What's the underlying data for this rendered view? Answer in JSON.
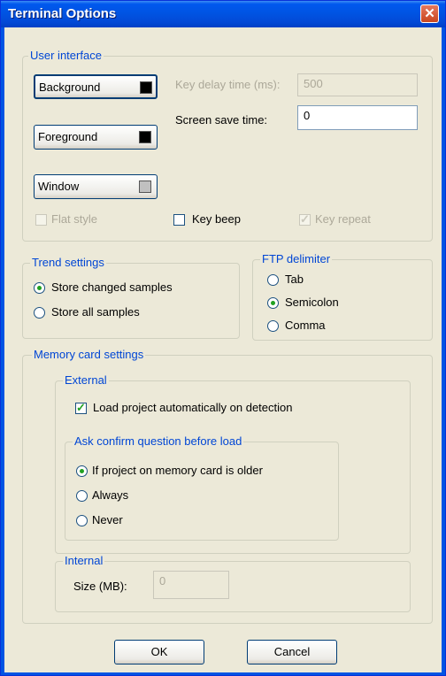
{
  "window": {
    "title": "Terminal Options",
    "close_glyph": "✕"
  },
  "user_interface": {
    "legend": "User interface",
    "background_button": "Background",
    "foreground_button": "Foreground",
    "window_button": "Window",
    "background_color": "#000000",
    "foreground_color": "#000000",
    "window_color": "#c0c0c0",
    "key_delay_label": "Key delay time (ms):",
    "key_delay_value": "500",
    "screen_save_label": "Screen save time:",
    "screen_save_value": "0",
    "flat_style_label": "Flat style",
    "key_beep_label": "Key beep",
    "key_repeat_label": "Key repeat"
  },
  "trend_settings": {
    "legend": "Trend settings",
    "store_changed": "Store changed samples",
    "store_all": "Store all samples"
  },
  "ftp_delimiter": {
    "legend": "FTP delimiter",
    "tab": "Tab",
    "semicolon": "Semicolon",
    "comma": "Comma"
  },
  "memory_card": {
    "legend": "Memory card settings",
    "external": {
      "legend": "External",
      "load_project_label": "Load project automatically on detection",
      "ask_confirm_legend": "Ask confirm question before load",
      "if_older": "If project on memory card is older",
      "always": "Always",
      "never": "Never"
    },
    "internal": {
      "legend": "Internal",
      "size_label": "Size (MB):",
      "size_value": "0"
    }
  },
  "footer": {
    "ok_label": "OK",
    "cancel_label": "Cancel"
  },
  "colors": {
    "accent_check": "#21a121",
    "legend_blue": "#0046d5"
  },
  "state": {
    "flat_style_checked": false,
    "key_beep_checked": false,
    "key_repeat_checked": true,
    "trend": "store_changed",
    "ftp": "semicolon",
    "load_project_checked": true,
    "ask_confirm": "if_older"
  }
}
